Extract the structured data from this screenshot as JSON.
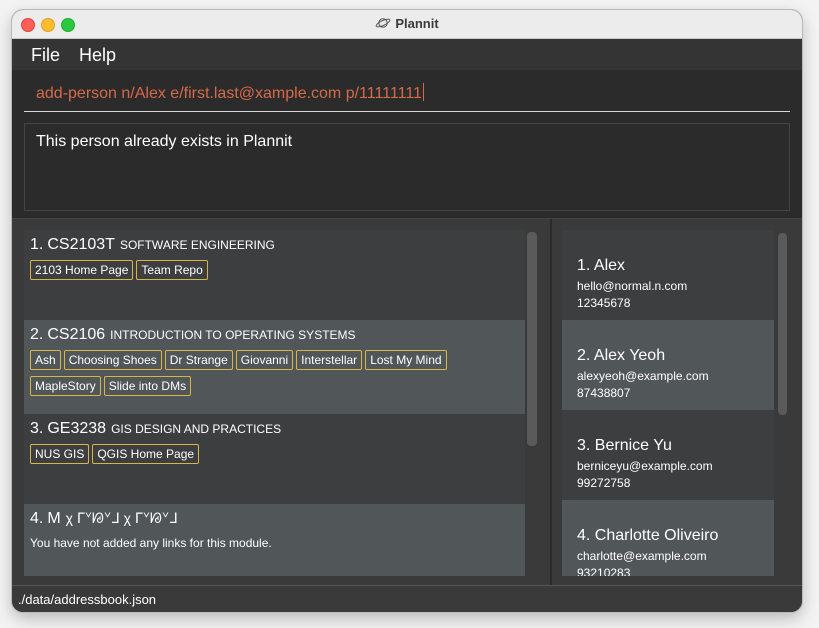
{
  "window": {
    "title": "Plannit"
  },
  "menu": {
    "file": "File",
    "help": "Help"
  },
  "command": {
    "value": "add-person n/Alex e/first.last@xample.com p/11111111"
  },
  "result": {
    "text": "This person already exists in Plannit"
  },
  "modules": [
    {
      "index": "1.",
      "code": "CS2103T",
      "name": "SOFTWARE ENGINEERING",
      "tags": [
        "2103 Home Page",
        "Team Repo"
      ]
    },
    {
      "index": "2.",
      "code": "CS2106",
      "name": "INTRODUCTION TO OPERATING SYSTEMS",
      "tags": [
        "Ash",
        "Choosing Shoes",
        "Dr Strange",
        "Giovanni",
        "Interstellar",
        "Lost My Mind",
        "MapleStory",
        "Slide into DMs"
      ]
    },
    {
      "index": "3.",
      "code": "GE3238",
      "name": "GIS DESIGN AND PRACTICES",
      "tags": [
        "NUS GIS",
        "QGIS Home Page"
      ]
    },
    {
      "index": "4.",
      "code": "M",
      "name": "χ ᒥᘁᘘᘁᒧ χ ᒥᘁᘘᘁᒧ",
      "tags": [],
      "empty_text": "You have not added any links for this module."
    }
  ],
  "persons": [
    {
      "index": "1.",
      "name": "Alex",
      "email": "hello@normal.n.com",
      "phone": "12345678"
    },
    {
      "index": "2.",
      "name": "Alex Yeoh",
      "email": "alexyeoh@example.com",
      "phone": "87438807"
    },
    {
      "index": "3.",
      "name": "Bernice Yu",
      "email": "berniceyu@example.com",
      "phone": "99272758"
    },
    {
      "index": "4.",
      "name": "Charlotte Oliveiro",
      "email": "charlotte@example.com",
      "phone": "93210283"
    }
  ],
  "status": {
    "path": "./data/addressbook.json"
  },
  "colors": {
    "tag_border": "#d8b44a",
    "command_text": "#d56a4a",
    "card_dark": "#3c3e3f",
    "card_light": "#515658"
  }
}
